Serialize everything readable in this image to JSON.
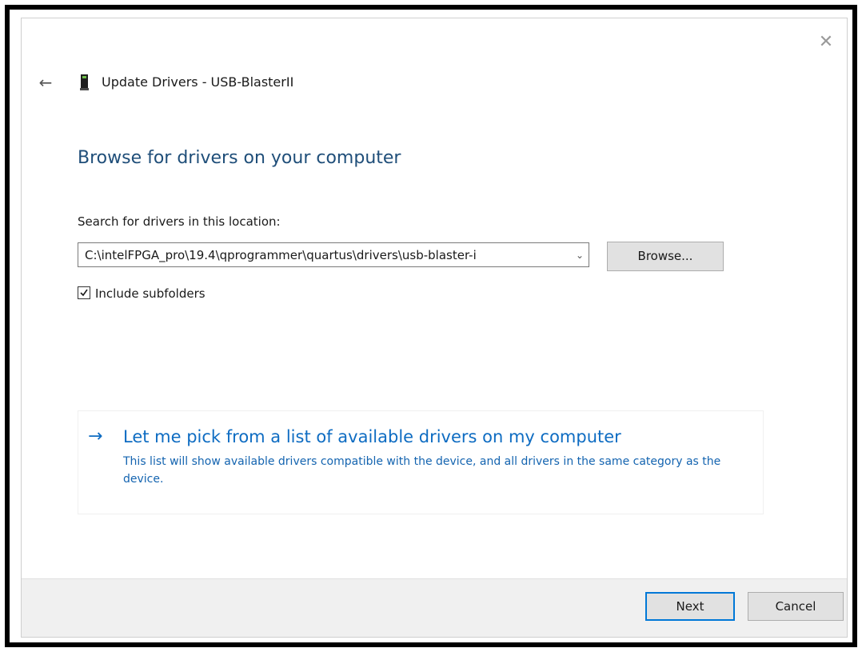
{
  "window": {
    "close_glyph": "✕",
    "back_glyph": "←",
    "title": "Update Drivers - USB-BlasterII",
    "device_icon": "usb-device-icon"
  },
  "page": {
    "heading": "Browse for drivers on your computer",
    "search_label": "Search for drivers in this location:",
    "path_value": "C:\\intelFPGA_pro\\19.4\\qprogrammer\\quartus\\drivers\\usb-blaster-i",
    "browse_label": "Browse...",
    "include_subfolders_label": "Include subfolders",
    "include_subfolders_checked": true
  },
  "pick_option": {
    "arrow_glyph": "→",
    "title": "Let me pick from a list of available drivers on my computer",
    "description": "This list will show available drivers compatible with the device, and all drivers in the same category as the device."
  },
  "footer": {
    "next_label": "Next",
    "cancel_label": "Cancel"
  },
  "colors": {
    "heading": "#1f4e79",
    "link": "#0e6cc2",
    "default_button_border": "#0078d7",
    "footer_bg": "#f0f0f0"
  }
}
